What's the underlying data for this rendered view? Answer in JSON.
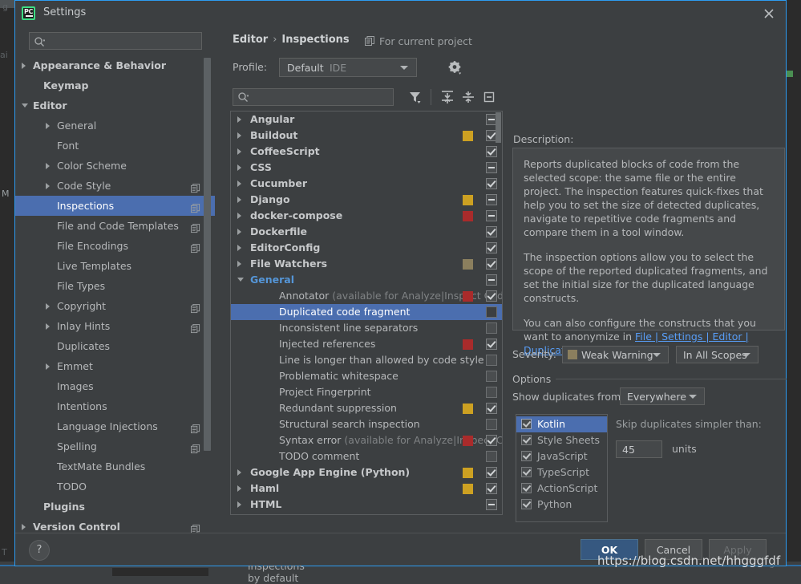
{
  "window": {
    "title": "Settings",
    "app_icon": "pycharm-icon",
    "close_icon": "close-icon",
    "border_color": "#2d9bf0"
  },
  "sidebar": {
    "search": {
      "placeholder": "",
      "value": "",
      "icon": "search-icon"
    },
    "items": [
      {
        "label": "Appearance & Behavior",
        "indent": 22,
        "arrow": "right",
        "bold": true,
        "copy": false,
        "selected": false
      },
      {
        "label": "Keymap",
        "indent": 35,
        "arrow": "none",
        "bold": true,
        "copy": false,
        "selected": false
      },
      {
        "label": "Editor",
        "indent": 22,
        "arrow": "down",
        "bold": true,
        "copy": false,
        "selected": false
      },
      {
        "label": "General",
        "indent": 52,
        "arrow": "right",
        "bold": false,
        "copy": false,
        "selected": false
      },
      {
        "label": "Font",
        "indent": 52,
        "arrow": "none",
        "bold": false,
        "copy": false,
        "selected": false
      },
      {
        "label": "Color Scheme",
        "indent": 52,
        "arrow": "right",
        "bold": false,
        "copy": false,
        "selected": false
      },
      {
        "label": "Code Style",
        "indent": 52,
        "arrow": "right",
        "bold": false,
        "copy": true,
        "selected": false
      },
      {
        "label": "Inspections",
        "indent": 52,
        "arrow": "none",
        "bold": false,
        "copy": true,
        "selected": true
      },
      {
        "label": "File and Code Templates",
        "indent": 52,
        "arrow": "none",
        "bold": false,
        "copy": true,
        "selected": false
      },
      {
        "label": "File Encodings",
        "indent": 52,
        "arrow": "none",
        "bold": false,
        "copy": true,
        "selected": false
      },
      {
        "label": "Live Templates",
        "indent": 52,
        "arrow": "none",
        "bold": false,
        "copy": false,
        "selected": false
      },
      {
        "label": "File Types",
        "indent": 52,
        "arrow": "none",
        "bold": false,
        "copy": false,
        "selected": false
      },
      {
        "label": "Copyright",
        "indent": 52,
        "arrow": "right",
        "bold": false,
        "copy": true,
        "selected": false
      },
      {
        "label": "Inlay Hints",
        "indent": 52,
        "arrow": "right",
        "bold": false,
        "copy": true,
        "selected": false
      },
      {
        "label": "Duplicates",
        "indent": 52,
        "arrow": "none",
        "bold": false,
        "copy": false,
        "selected": false
      },
      {
        "label": "Emmet",
        "indent": 52,
        "arrow": "right",
        "bold": false,
        "copy": false,
        "selected": false
      },
      {
        "label": "Images",
        "indent": 52,
        "arrow": "none",
        "bold": false,
        "copy": false,
        "selected": false
      },
      {
        "label": "Intentions",
        "indent": 52,
        "arrow": "none",
        "bold": false,
        "copy": false,
        "selected": false
      },
      {
        "label": "Language Injections",
        "indent": 52,
        "arrow": "none",
        "bold": false,
        "copy": true,
        "selected": false
      },
      {
        "label": "Spelling",
        "indent": 52,
        "arrow": "none",
        "bold": false,
        "copy": true,
        "selected": false
      },
      {
        "label": "TextMate Bundles",
        "indent": 52,
        "arrow": "none",
        "bold": false,
        "copy": false,
        "selected": false
      },
      {
        "label": "TODO",
        "indent": 52,
        "arrow": "none",
        "bold": false,
        "copy": false,
        "selected": false
      },
      {
        "label": "Plugins",
        "indent": 35,
        "arrow": "none",
        "bold": true,
        "copy": false,
        "selected": false
      },
      {
        "label": "Version Control",
        "indent": 22,
        "arrow": "right",
        "bold": true,
        "copy": true,
        "selected": false
      }
    ]
  },
  "header": {
    "breadcrumb_root": "Editor",
    "breadcrumb_sep": "›",
    "breadcrumb_leaf": "Inspections",
    "for_current_project": "For current project",
    "for_current_project_icon": "copy-icon",
    "profile_label": "Profile:",
    "profile_value": "Default",
    "profile_scope": "IDE",
    "gear_icon": "gear-icon",
    "dropdown_icon": "chevron-down-icon"
  },
  "toolbar": {
    "search_placeholder": "",
    "search_value": "",
    "search_icon": "search-icon",
    "filter_icon": "filter-icon",
    "expand_all_icon": "expand-all-icon",
    "collapse_all_icon": "collapse-all-icon",
    "reset_icon": "reset-icon"
  },
  "inspections": [
    {
      "label": "Angular",
      "indent": 24,
      "arrow": "right",
      "type": "group",
      "swatch": null,
      "check": "dash"
    },
    {
      "label": "Buildout",
      "indent": 24,
      "arrow": "right",
      "type": "group",
      "swatch": "#cda122",
      "check": "on"
    },
    {
      "label": "CoffeeScript",
      "indent": 24,
      "arrow": "right",
      "type": "group",
      "swatch": null,
      "check": "on"
    },
    {
      "label": "CSS",
      "indent": 24,
      "arrow": "right",
      "type": "group",
      "swatch": null,
      "check": "dash"
    },
    {
      "label": "Cucumber",
      "indent": 24,
      "arrow": "right",
      "type": "group",
      "swatch": null,
      "check": "on"
    },
    {
      "label": "Django",
      "indent": 24,
      "arrow": "right",
      "type": "group",
      "swatch": "#cda122",
      "check": "dash"
    },
    {
      "label": "docker-compose",
      "indent": 24,
      "arrow": "right",
      "type": "group",
      "swatch": "#a92b2b",
      "check": "dash"
    },
    {
      "label": "Dockerfile",
      "indent": 24,
      "arrow": "right",
      "type": "group",
      "swatch": null,
      "check": "on"
    },
    {
      "label": "EditorConfig",
      "indent": 24,
      "arrow": "right",
      "type": "group",
      "swatch": null,
      "check": "on"
    },
    {
      "label": "File Watchers",
      "indent": 24,
      "arrow": "right",
      "type": "group",
      "swatch": "#8b7f5e",
      "check": "on"
    },
    {
      "label": "General",
      "indent": 24,
      "arrow": "down",
      "type": "group-selected",
      "swatch": null,
      "check": "dash"
    },
    {
      "label": "Annotator",
      "sub": " (available for Analyze|Inspect Cod",
      "indent": 60,
      "arrow": "none",
      "type": "leaf",
      "swatch": "#a92b2b",
      "check": "on"
    },
    {
      "label": "Duplicated code fragment",
      "indent": 60,
      "arrow": "none",
      "type": "leaf-selected",
      "swatch": null,
      "check": "blank-dark"
    },
    {
      "label": "Inconsistent line separators",
      "indent": 60,
      "arrow": "none",
      "type": "leaf",
      "swatch": null,
      "check": "off"
    },
    {
      "label": "Injected references",
      "indent": 60,
      "arrow": "none",
      "type": "leaf",
      "swatch": "#a92b2b",
      "check": "on"
    },
    {
      "label": "Line is longer than allowed by code style",
      "indent": 60,
      "arrow": "none",
      "type": "leaf",
      "swatch": null,
      "check": "off"
    },
    {
      "label": "Problematic whitespace",
      "indent": 60,
      "arrow": "none",
      "type": "leaf",
      "swatch": null,
      "check": "off"
    },
    {
      "label": "Project Fingerprint",
      "indent": 60,
      "arrow": "none",
      "type": "leaf",
      "swatch": null,
      "check": "off"
    },
    {
      "label": "Redundant suppression",
      "indent": 60,
      "arrow": "none",
      "type": "leaf",
      "swatch": "#cda122",
      "check": "on"
    },
    {
      "label": "Structural search inspection",
      "indent": 60,
      "arrow": "none",
      "type": "leaf",
      "swatch": null,
      "check": "off"
    },
    {
      "label": "Syntax error",
      "sub": " (available for Analyze|Inspect Cà",
      "indent": 60,
      "arrow": "none",
      "type": "leaf",
      "swatch": "#a92b2b",
      "check": "on"
    },
    {
      "label": "TODO comment",
      "indent": 60,
      "arrow": "none",
      "type": "leaf",
      "swatch": null,
      "check": "off"
    },
    {
      "label": "Google App Engine (Python)",
      "indent": 24,
      "arrow": "right",
      "type": "group",
      "swatch": "#cda122",
      "check": "on"
    },
    {
      "label": "Haml",
      "indent": 24,
      "arrow": "right",
      "type": "group",
      "swatch": "#cda122",
      "check": "on"
    },
    {
      "label": "HTML",
      "indent": 24,
      "arrow": "right",
      "type": "group",
      "swatch": null,
      "check": "dash"
    }
  ],
  "description": {
    "label": "Description:",
    "paragraphs": [
      "Reports duplicated blocks of code from the selected scope: the same file or the entire project. The inspection features quick-fixes that help you to set the size of detected duplicates, navigate to repetitive code fragments and compare them in a tool window.",
      "The inspection options allow you to select the scope of the reported duplicated fragments, and set the initial size for the duplicated language constructs."
    ],
    "last_prefix": "You can also configure the constructs that you want to anonymize in ",
    "last_link": "File | Settings | Editor | Duplicates",
    "last_suffix": "."
  },
  "severity": {
    "label": "Severity:",
    "value": "Weak Warning",
    "swatch_color": "#8b7f5e",
    "scope_value": "In All Scopes"
  },
  "options": {
    "title": "Options",
    "show_duplicates_label": "Show duplicates from:",
    "show_duplicates_value": "Everywhere",
    "languages": [
      {
        "label": "Kotlin",
        "checked": true,
        "selected": true
      },
      {
        "label": "Style Sheets",
        "checked": true,
        "selected": false
      },
      {
        "label": "JavaScript",
        "checked": true,
        "selected": false
      },
      {
        "label": "TypeScript",
        "checked": true,
        "selected": false
      },
      {
        "label": "ActionScript",
        "checked": true,
        "selected": false
      },
      {
        "label": "Python",
        "checked": true,
        "selected": false
      }
    ],
    "skip_label": "Skip duplicates simpler than:",
    "skip_value": "45",
    "skip_units": "units"
  },
  "disable_new": {
    "label": "Disable new inspections by default",
    "checked": false
  },
  "footer": {
    "help_label": "?",
    "ok_label": "OK",
    "cancel_label": "Cancel",
    "apply_label": "Apply"
  },
  "watermark": "https://blog.csdn.net/hhgggfdf",
  "background": {
    "left_fragments": [
      "g",
      "ai",
      "M",
      "T"
    ],
    "colors": {
      "accent": "#4b6eaf",
      "dialog_bg": "#3c3f41",
      "ide_bg": "#2b2b2b"
    }
  }
}
